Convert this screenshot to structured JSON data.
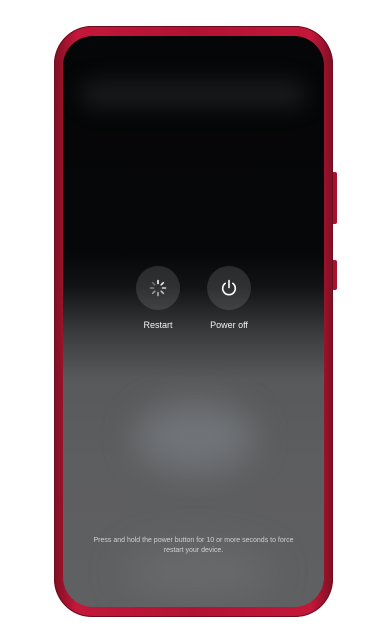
{
  "power_menu": {
    "restart": {
      "label": "Restart",
      "icon": "restart-spinner-icon"
    },
    "power_off": {
      "label": "Power off",
      "icon": "power-icon"
    },
    "hint": "Press and hold the power button for 10 or more seconds to force restart your device."
  },
  "colors": {
    "phone_frame": "#b21232",
    "screen_top": "#050607",
    "screen_bottom": "#5f6062"
  }
}
